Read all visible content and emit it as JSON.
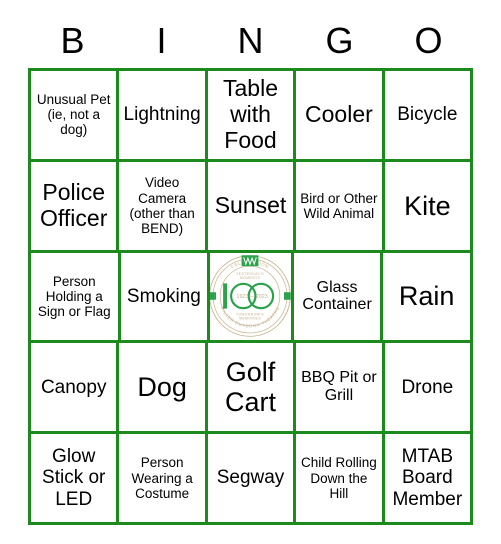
{
  "card": {
    "title": "BINGO",
    "accent_color": "#1d8a1d",
    "text_color": "#000000",
    "background_color": "#ffffff",
    "headers": [
      "B",
      "I",
      "N",
      "G",
      "O"
    ],
    "rows": [
      [
        {
          "text": "Unusual Pet (ie, not a dog)",
          "size": "xs"
        },
        {
          "text": "Lightning",
          "size": "md"
        },
        {
          "text": "Table with Food",
          "size": "lg"
        },
        {
          "text": "Cooler",
          "size": "lg"
        },
        {
          "text": "Bicycle",
          "size": "md"
        }
      ],
      [
        {
          "text": "Police Officer",
          "size": "lg"
        },
        {
          "text": "Video Camera (other than BEND)",
          "size": "xs"
        },
        {
          "text": "Sunset",
          "size": "lg"
        },
        {
          "text": "Bird or Other Wild Animal",
          "size": "xs"
        },
        {
          "text": "Kite",
          "size": "xl"
        }
      ],
      [
        {
          "text": "Person Holding a Sign or Flag",
          "size": "xs"
        },
        {
          "text": "Smoking",
          "size": "md"
        },
        {
          "text": "",
          "size": "md",
          "free_space": true
        },
        {
          "text": "Glass Container",
          "size": "sm"
        },
        {
          "text": "Rain",
          "size": "xl"
        }
      ],
      [
        {
          "text": "Canopy",
          "size": "md"
        },
        {
          "text": "Dog",
          "size": "xl"
        },
        {
          "text": "Golf Cart",
          "size": "xl"
        },
        {
          "text": "BBQ Pit or Grill",
          "size": "sm"
        },
        {
          "text": "Drone",
          "size": "md"
        }
      ],
      [
        {
          "text": "Glow Stick or LED",
          "size": "md"
        },
        {
          "text": "Person Wearing a Costume",
          "size": "xs"
        },
        {
          "text": "Segway",
          "size": "md"
        },
        {
          "text": "Child Rolling Down the Hill",
          "size": "xs"
        },
        {
          "text": "MTAB Board Member",
          "size": "md"
        }
      ]
    ],
    "free_space_seal": {
      "top_text": "YESTERDAY'S MOMENTS",
      "bottom_text": "TOMORROW'S MEMORIES",
      "number": "100",
      "year_start": "1923",
      "year_end": "2023",
      "year_separator": "—",
      "ring_text_top": "CELEBRATION",
      "ring_text_bottom": "MILLER OUTDOOR THEATRE",
      "ring_color": "#c6b08a",
      "mark_color": "#2aa34a"
    }
  }
}
